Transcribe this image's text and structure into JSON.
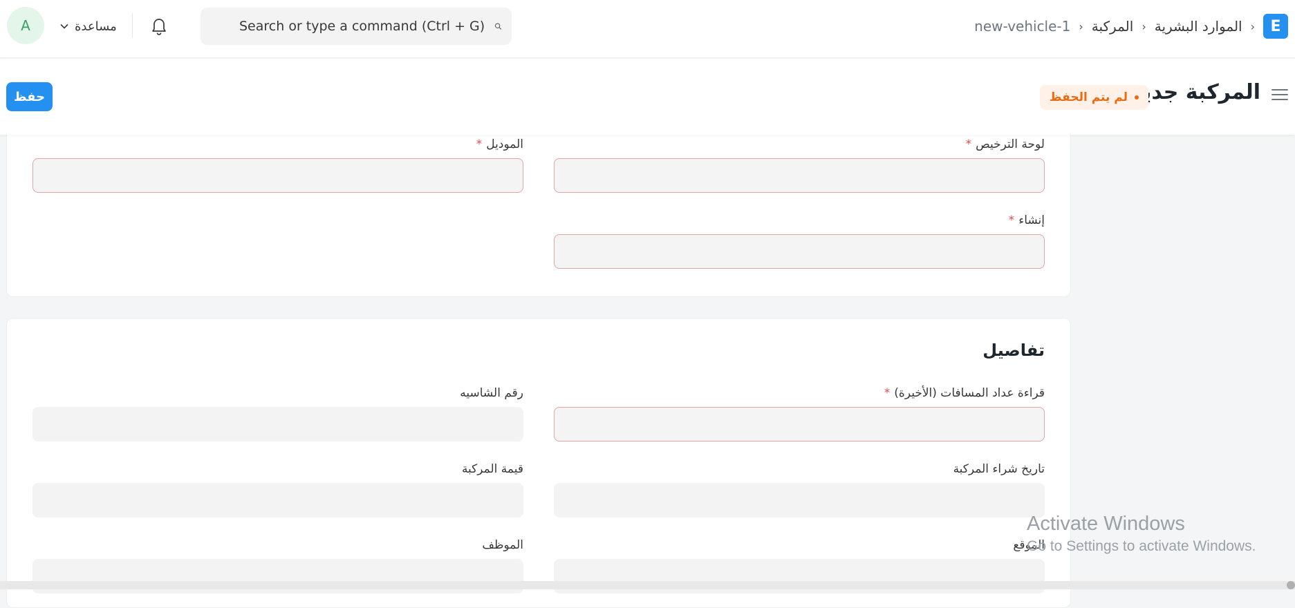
{
  "navbar": {
    "avatar_letter": "A",
    "help_label": "مساعدة",
    "search_placeholder": "Search or type a command (Ctrl + G)",
    "breadcrumb": {
      "app_logo_letter": "E",
      "module": "الموارد البشرية",
      "doctype": "المركبة",
      "current": "new-vehicle-1"
    }
  },
  "page_head": {
    "title": "المركبة جديد",
    "indicator": "لم يتم الحفظ",
    "save_label": "حفظ"
  },
  "section_1": {
    "fields": {
      "license_plate": {
        "label": "لوحة الترخيص",
        "value": ""
      },
      "model": {
        "label": "الموديل",
        "value": ""
      },
      "make": {
        "label": "إنشاء",
        "value": ""
      }
    }
  },
  "section_2": {
    "title": "تفاصيل",
    "fields": {
      "last_odometer": {
        "label": "قراءة عداد المسافات (الأخيرة)",
        "value": ""
      },
      "chassis_no": {
        "label": "رقم الشاسيه",
        "value": ""
      },
      "acquisition_date": {
        "label": "تاريخ شراء المركبة",
        "value": ""
      },
      "vehicle_value": {
        "label": "قيمة المركبة",
        "value": ""
      },
      "location": {
        "label": "الموقع",
        "value": ""
      },
      "employee": {
        "label": "الموظف",
        "value": ""
      }
    }
  },
  "required_marker": "*",
  "watermark": {
    "line1": "Activate Windows",
    "line2": "Go to Settings to activate Windows."
  },
  "colors": {
    "primary": "#2490ef",
    "indicator_orange": "#e86c13",
    "required_red": "#e24c4c"
  }
}
